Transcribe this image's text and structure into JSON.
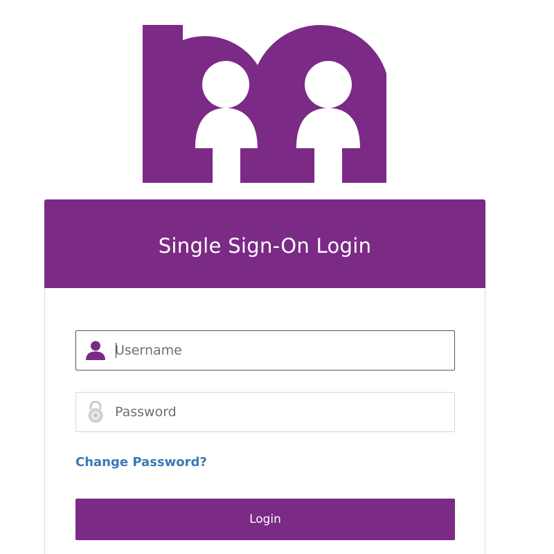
{
  "brand": {
    "logo_icon": "family-m-logo",
    "color": "#7b2a86"
  },
  "login": {
    "title": "Single Sign-On Login",
    "username": {
      "placeholder": "Username",
      "value": "",
      "icon": "user-icon"
    },
    "password": {
      "placeholder": "Password",
      "value": "",
      "icon": "padlock-icon"
    },
    "change_password_label": "Change Password?",
    "login_label": "Login",
    "link_color": "#3a79b5"
  }
}
